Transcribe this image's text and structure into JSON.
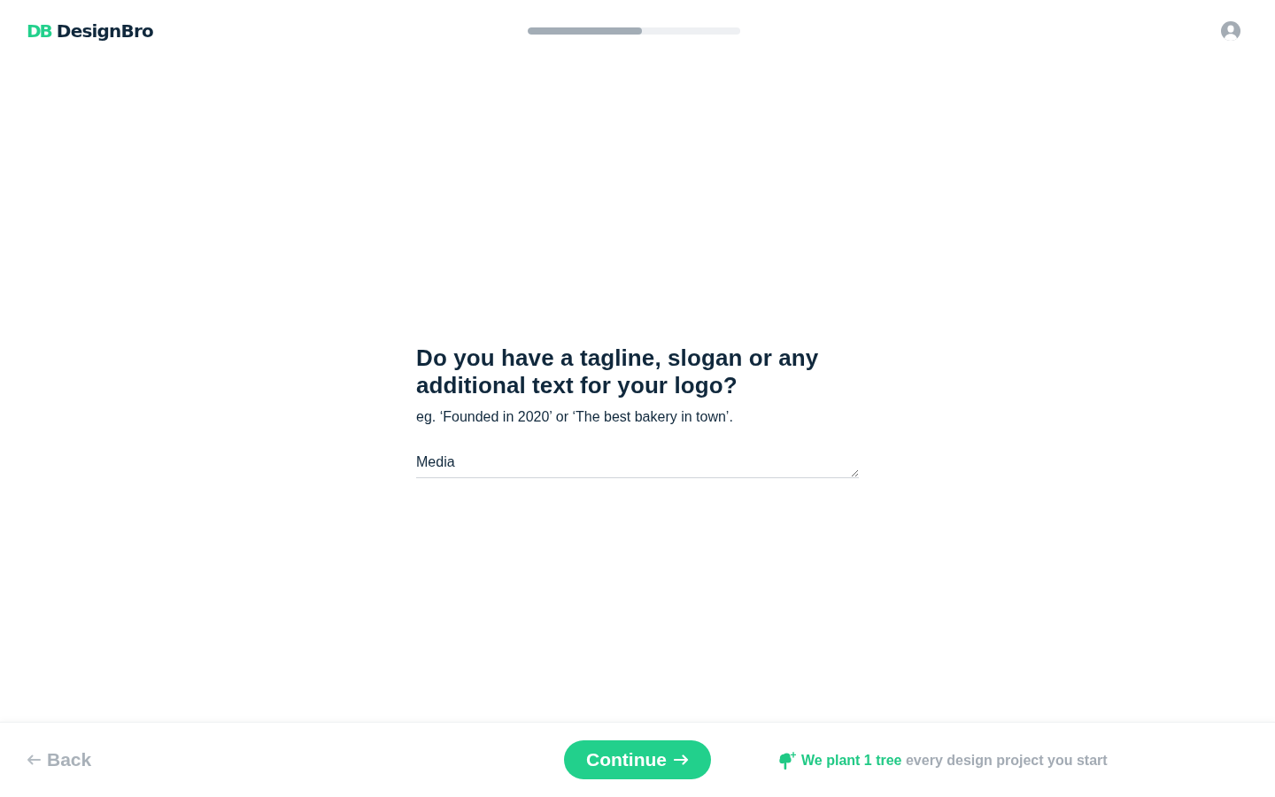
{
  "header": {
    "logo": {
      "mark": "DB",
      "name": "DesignBro"
    },
    "progress": {
      "level": 0.54
    }
  },
  "question": {
    "title": "Do you have a tagline, slogan or any additional text for your logo?",
    "hint": "eg. ‘Founded in 2020’ or ‘The best bakery in town’.",
    "answer": {
      "value": "Media"
    }
  },
  "footer": {
    "back": {
      "label": "Back"
    },
    "continue": {
      "label": "Continue"
    },
    "note": {
      "highlight": "We plant 1 tree",
      "text": "every design project you start"
    }
  }
}
